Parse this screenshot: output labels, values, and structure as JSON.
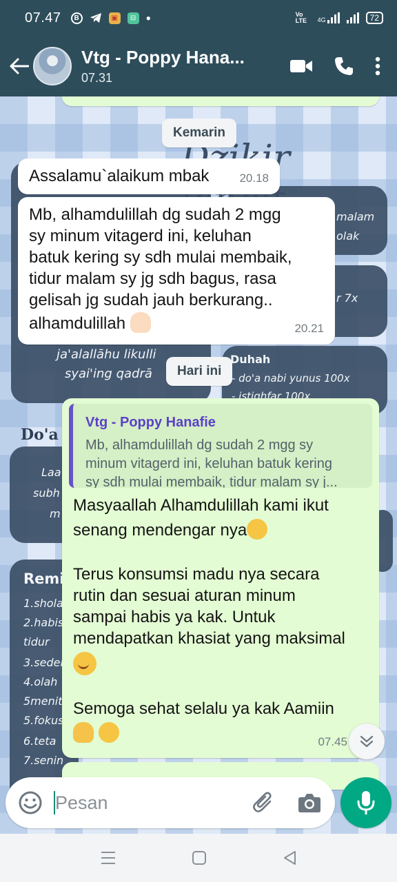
{
  "status_bar": {
    "time": "07.47",
    "volte": "Vo LTE",
    "network": "4G",
    "battery": "72"
  },
  "header": {
    "title": "Vtg - Poppy Hana...",
    "subtitle": "07.31"
  },
  "date_chips": {
    "yesterday": "Kemarin",
    "today": "Hari ini"
  },
  "messages": {
    "m1": {
      "text": "Assalamu`alaikum mbak",
      "time": "20.18"
    },
    "m2": {
      "lines": [
        "Mb, alhamdulillah dg sudah 2 mgg",
        "sy minum vitagerd ini, keluhan",
        "batuk kering sy sdh mulai membaik,",
        "tidur malam sy jg sdh bagus, rasa",
        "gelisah jg sudah jauh berkurang..",
        "alhamdulillah"
      ],
      "time": "20.21"
    },
    "m3": {
      "quote_name": "Vtg - Poppy Hanafie",
      "quote_lines": [
        "Mb, alhamdulillah dg sudah 2 mgg sy",
        "minum vitagerd ini, keluhan batuk kering",
        "sy sdh mulai membaik, tidur malam sy j..."
      ],
      "p1_line1": "Masyaallah Alhamdulillah kami ikut",
      "p1_line2": "senang mendengar nya",
      "p2_lines": [
        "Terus konsumsi madu nya secara",
        "rutin dan sesuai aturan minum",
        "sampai habis  ya kak. Untuk",
        "mendapatkan khasiat yang maksimal"
      ],
      "p3": "Semoga sehat selalu ya kak Aamiin",
      "time": "07.45"
    }
  },
  "wallpaper": {
    "title": "Dzikir langit",
    "t1": "malam",
    "t2": "olak",
    "t3": "r 7x",
    "dua_line1": "ja'alallāhu likulli",
    "dua_line2": "syai'ing qadrā",
    "duhah": "Duhah",
    "duhah_l1": "-  do'a nabi yunus 100x",
    "duhah_l2": "-  istighfar 100x",
    "doa": "Do'a",
    "lai1": "Laa",
    "lai2": "subh",
    "lai3": "m",
    "remi": "Remi",
    "rem_items": [
      "1.shola",
      "2.habis",
      "tidur",
      "3.sedek",
      "4.olah",
      "5menit",
      "5.fokus",
      "6.teta",
      "7.senin"
    ]
  },
  "input": {
    "placeholder": "Pesan"
  },
  "colors": {
    "header": "#2e4d5b",
    "outgoing": "#e3fcd3",
    "incoming": "#ffffff",
    "accent": "#00a884",
    "quote_name": "#5a41c8"
  }
}
